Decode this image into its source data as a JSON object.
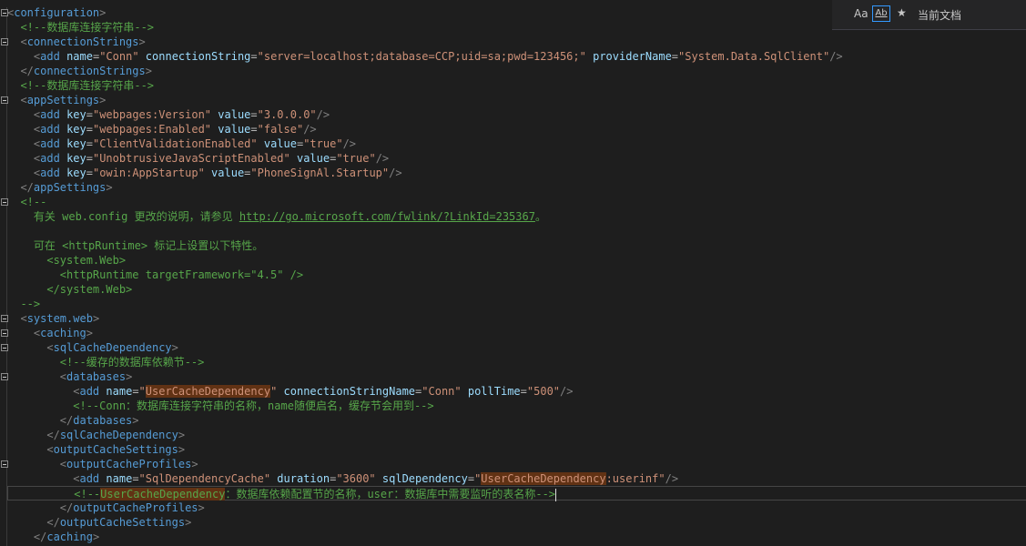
{
  "editor": {
    "lines": [
      [
        {
          "t": "<",
          "c": "punct"
        },
        {
          "t": "configuration",
          "c": "tag"
        },
        {
          "t": ">",
          "c": "punct"
        }
      ],
      [
        {
          "t": "  "
        },
        {
          "t": "<!--数据库连接字符串-->",
          "c": "comment"
        }
      ],
      [
        {
          "t": "  "
        },
        {
          "t": "<",
          "c": "punct"
        },
        {
          "t": "connectionStrings",
          "c": "tag"
        },
        {
          "t": ">",
          "c": "punct"
        }
      ],
      [
        {
          "t": "    "
        },
        {
          "t": "<",
          "c": "punct"
        },
        {
          "t": "add",
          "c": "tag"
        },
        {
          "t": " "
        },
        {
          "t": "name",
          "c": "attr"
        },
        {
          "t": "=",
          "c": "eq"
        },
        {
          "t": "\"Conn\"",
          "c": "val"
        },
        {
          "t": " "
        },
        {
          "t": "connectionString",
          "c": "attr"
        },
        {
          "t": "=",
          "c": "eq"
        },
        {
          "t": "\"server=localhost;database=CCP;uid=sa;pwd=123456;\"",
          "c": "val"
        },
        {
          "t": " "
        },
        {
          "t": "providerName",
          "c": "attr"
        },
        {
          "t": "=",
          "c": "eq"
        },
        {
          "t": "\"System.Data.SqlClient\"",
          "c": "val"
        },
        {
          "t": "/>",
          "c": "punct"
        }
      ],
      [
        {
          "t": "  "
        },
        {
          "t": "</",
          "c": "punct"
        },
        {
          "t": "connectionStrings",
          "c": "tag"
        },
        {
          "t": ">",
          "c": "punct"
        }
      ],
      [
        {
          "t": "  "
        },
        {
          "t": "<!--数据库连接字符串-->",
          "c": "comment"
        }
      ],
      [
        {
          "t": "  "
        },
        {
          "t": "<",
          "c": "punct"
        },
        {
          "t": "appSettings",
          "c": "tag"
        },
        {
          "t": ">",
          "c": "punct"
        }
      ],
      [
        {
          "t": "    "
        },
        {
          "t": "<",
          "c": "punct"
        },
        {
          "t": "add",
          "c": "tag"
        },
        {
          "t": " "
        },
        {
          "t": "key",
          "c": "attr"
        },
        {
          "t": "=",
          "c": "eq"
        },
        {
          "t": "\"webpages:Version\"",
          "c": "val"
        },
        {
          "t": " "
        },
        {
          "t": "value",
          "c": "attr"
        },
        {
          "t": "=",
          "c": "eq"
        },
        {
          "t": "\"3.0.0.0\"",
          "c": "val"
        },
        {
          "t": "/>",
          "c": "punct"
        }
      ],
      [
        {
          "t": "    "
        },
        {
          "t": "<",
          "c": "punct"
        },
        {
          "t": "add",
          "c": "tag"
        },
        {
          "t": " "
        },
        {
          "t": "key",
          "c": "attr"
        },
        {
          "t": "=",
          "c": "eq"
        },
        {
          "t": "\"webpages:Enabled\"",
          "c": "val"
        },
        {
          "t": " "
        },
        {
          "t": "value",
          "c": "attr"
        },
        {
          "t": "=",
          "c": "eq"
        },
        {
          "t": "\"false\"",
          "c": "val"
        },
        {
          "t": "/>",
          "c": "punct"
        }
      ],
      [
        {
          "t": "    "
        },
        {
          "t": "<",
          "c": "punct"
        },
        {
          "t": "add",
          "c": "tag"
        },
        {
          "t": " "
        },
        {
          "t": "key",
          "c": "attr"
        },
        {
          "t": "=",
          "c": "eq"
        },
        {
          "t": "\"ClientValidationEnabled\"",
          "c": "val"
        },
        {
          "t": " "
        },
        {
          "t": "value",
          "c": "attr"
        },
        {
          "t": "=",
          "c": "eq"
        },
        {
          "t": "\"true\"",
          "c": "val"
        },
        {
          "t": "/>",
          "c": "punct"
        }
      ],
      [
        {
          "t": "    "
        },
        {
          "t": "<",
          "c": "punct"
        },
        {
          "t": "add",
          "c": "tag"
        },
        {
          "t": " "
        },
        {
          "t": "key",
          "c": "attr"
        },
        {
          "t": "=",
          "c": "eq"
        },
        {
          "t": "\"UnobtrusiveJavaScriptEnabled\"",
          "c": "val"
        },
        {
          "t": " "
        },
        {
          "t": "value",
          "c": "attr"
        },
        {
          "t": "=",
          "c": "eq"
        },
        {
          "t": "\"true\"",
          "c": "val"
        },
        {
          "t": "/>",
          "c": "punct"
        }
      ],
      [
        {
          "t": "    "
        },
        {
          "t": "<",
          "c": "punct"
        },
        {
          "t": "add",
          "c": "tag"
        },
        {
          "t": " "
        },
        {
          "t": "key",
          "c": "attr"
        },
        {
          "t": "=",
          "c": "eq"
        },
        {
          "t": "\"owin:AppStartup\"",
          "c": "val"
        },
        {
          "t": " "
        },
        {
          "t": "value",
          "c": "attr"
        },
        {
          "t": "=",
          "c": "eq"
        },
        {
          "t": "\"PhoneSignAl.Startup\"",
          "c": "val"
        },
        {
          "t": "/>",
          "c": "punct"
        }
      ],
      [
        {
          "t": "  "
        },
        {
          "t": "</",
          "c": "punct"
        },
        {
          "t": "appSettings",
          "c": "tag"
        },
        {
          "t": ">",
          "c": "punct"
        }
      ],
      [
        {
          "t": "  "
        },
        {
          "t": "<!--",
          "c": "comment"
        }
      ],
      [
        {
          "t": "    有关 web.config 更改的说明，请参见 ",
          "c": "comment"
        },
        {
          "t": "http://go.microsoft.com/fwlink/?LinkId=235367",
          "c": "link"
        },
        {
          "t": "。",
          "c": "comment"
        }
      ],
      [
        {
          "t": ""
        }
      ],
      [
        {
          "t": "    可在 <httpRuntime> 标记上设置以下特性。",
          "c": "comment"
        }
      ],
      [
        {
          "t": "      <system.Web>",
          "c": "comment"
        }
      ],
      [
        {
          "t": "        <httpRuntime targetFramework=\"4.5\" />",
          "c": "comment"
        }
      ],
      [
        {
          "t": "      </system.Web>",
          "c": "comment"
        }
      ],
      [
        {
          "t": "  -->",
          "c": "comment"
        }
      ],
      [
        {
          "t": "  "
        },
        {
          "t": "<",
          "c": "punct"
        },
        {
          "t": "system.web",
          "c": "tag"
        },
        {
          "t": ">",
          "c": "punct"
        }
      ],
      [
        {
          "t": "    "
        },
        {
          "t": "<",
          "c": "punct"
        },
        {
          "t": "caching",
          "c": "tag"
        },
        {
          "t": ">",
          "c": "punct"
        }
      ],
      [
        {
          "t": "      "
        },
        {
          "t": "<",
          "c": "punct"
        },
        {
          "t": "sqlCacheDependency",
          "c": "tag"
        },
        {
          "t": ">",
          "c": "punct"
        }
      ],
      [
        {
          "t": "        "
        },
        {
          "t": "<!--缓存的数据库依赖节-->",
          "c": "comment"
        }
      ],
      [
        {
          "t": "        "
        },
        {
          "t": "<",
          "c": "punct"
        },
        {
          "t": "databases",
          "c": "tag"
        },
        {
          "t": ">",
          "c": "punct"
        }
      ],
      [
        {
          "t": "          "
        },
        {
          "t": "<",
          "c": "punct"
        },
        {
          "t": "add",
          "c": "tag"
        },
        {
          "t": " "
        },
        {
          "t": "name",
          "c": "attr"
        },
        {
          "t": "=",
          "c": "eq"
        },
        {
          "t": "\"",
          "c": "val"
        },
        {
          "t": "UserCacheDependency",
          "c": "val",
          "h": 1
        },
        {
          "t": "\"",
          "c": "val"
        },
        {
          "t": " "
        },
        {
          "t": "connectionStringName",
          "c": "attr"
        },
        {
          "t": "=",
          "c": "eq"
        },
        {
          "t": "\"Conn\"",
          "c": "val"
        },
        {
          "t": " "
        },
        {
          "t": "pollTime",
          "c": "attr"
        },
        {
          "t": "=",
          "c": "eq"
        },
        {
          "t": "\"500\"",
          "c": "val"
        },
        {
          "t": "/>",
          "c": "punct"
        }
      ],
      [
        {
          "t": "          "
        },
        {
          "t": "<!--Conn：数据库连接字符串的名称，name随便启名，缓存节会用到-->",
          "c": "comment"
        }
      ],
      [
        {
          "t": "        "
        },
        {
          "t": "</",
          "c": "punct"
        },
        {
          "t": "databases",
          "c": "tag"
        },
        {
          "t": ">",
          "c": "punct"
        }
      ],
      [
        {
          "t": "      "
        },
        {
          "t": "</",
          "c": "punct"
        },
        {
          "t": "sqlCacheDependency",
          "c": "tag"
        },
        {
          "t": ">",
          "c": "punct"
        }
      ],
      [
        {
          "t": "      "
        },
        {
          "t": "<",
          "c": "punct"
        },
        {
          "t": "outputCacheSettings",
          "c": "tag"
        },
        {
          "t": ">",
          "c": "punct"
        }
      ],
      [
        {
          "t": "        "
        },
        {
          "t": "<",
          "c": "punct"
        },
        {
          "t": "outputCacheProfiles",
          "c": "tag"
        },
        {
          "t": ">",
          "c": "punct"
        }
      ],
      [
        {
          "t": "          "
        },
        {
          "t": "<",
          "c": "punct"
        },
        {
          "t": "add",
          "c": "tag"
        },
        {
          "t": " "
        },
        {
          "t": "name",
          "c": "attr"
        },
        {
          "t": "=",
          "c": "eq"
        },
        {
          "t": "\"SqlDependencyCache\"",
          "c": "val"
        },
        {
          "t": " "
        },
        {
          "t": "duration",
          "c": "attr"
        },
        {
          "t": "=",
          "c": "eq"
        },
        {
          "t": "\"3600\"",
          "c": "val"
        },
        {
          "t": " "
        },
        {
          "t": "sqlDependency",
          "c": "attr"
        },
        {
          "t": "=",
          "c": "eq"
        },
        {
          "t": "\"",
          "c": "val"
        },
        {
          "t": "UserCacheDependency",
          "c": "val",
          "h": 1
        },
        {
          "t": ":userinf\"",
          "c": "val"
        },
        {
          "t": "/>",
          "c": "punct"
        }
      ],
      [
        {
          "t": "          "
        },
        {
          "t": "<!--",
          "c": "comment"
        },
        {
          "t": "UserCacheDependency",
          "c": "comment",
          "h": 1
        },
        {
          "t": "：数据库依赖配置节的名称，user：数据库中需要监听的表名称-->",
          "c": "comment"
        }
      ],
      [
        {
          "t": "        "
        },
        {
          "t": "</",
          "c": "punct"
        },
        {
          "t": "outputCacheProfiles",
          "c": "tag"
        },
        {
          "t": ">",
          "c": "punct"
        }
      ],
      [
        {
          "t": "      "
        },
        {
          "t": "</",
          "c": "punct"
        },
        {
          "t": "outputCacheSettings",
          "c": "tag"
        },
        {
          "t": ">",
          "c": "punct"
        }
      ],
      [
        {
          "t": "    "
        },
        {
          "t": "</",
          "c": "punct"
        },
        {
          "t": "caching",
          "c": "tag"
        },
        {
          "t": ">",
          "c": "punct"
        }
      ]
    ],
    "fold_lines": [
      0,
      2,
      6,
      13,
      21,
      22,
      23,
      25,
      31
    ]
  },
  "find_panel": {
    "match_case_label": "Aa",
    "whole_word_label": "Ab",
    "regex_label": "★",
    "scope_label": "当前文档"
  }
}
